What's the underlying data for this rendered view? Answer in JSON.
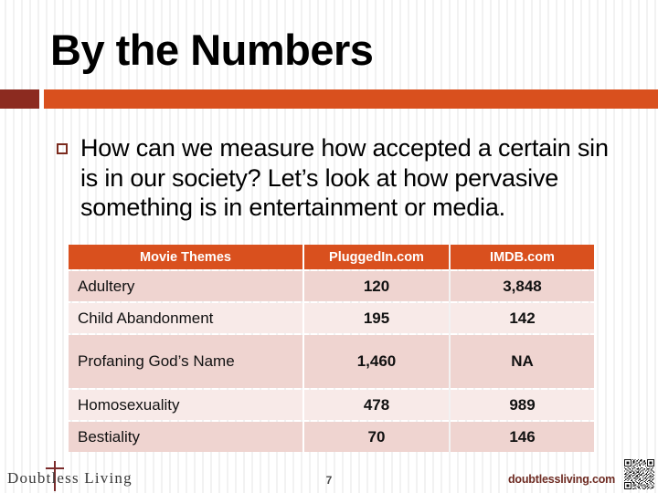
{
  "slide": {
    "title": "By the Numbers",
    "accent_color": "#D9501E",
    "accent_dark_color": "#8C2B20",
    "bullet_color": "#7B2B1E",
    "row_dark_color": "#EFD4D0",
    "row_light_color": "#F8EAE8"
  },
  "body": {
    "bullet_marker": "hollow-square-bullet",
    "paragraph": "How can we measure how accepted a certain sin is in our society? Let’s look at how pervasive something is in entertainment or media."
  },
  "table": {
    "headers": [
      "Movie Themes",
      "PluggedIn.com",
      "IMDB.com"
    ],
    "rows": [
      {
        "theme": "Adultery",
        "pluggedin": "120",
        "imdb": "3,848"
      },
      {
        "theme": "Child Abandonment",
        "pluggedin": "195",
        "imdb": "142"
      },
      {
        "theme": "Profaning God’s Name",
        "pluggedin": "1,460",
        "imdb": "NA"
      },
      {
        "theme": "Homosexuality",
        "pluggedin": "478",
        "imdb": "989"
      },
      {
        "theme": "Bestiality",
        "pluggedin": "70",
        "imdb": "146"
      }
    ]
  },
  "footer": {
    "logo_text": "Doubtless Living",
    "logo_icon": "cross-icon",
    "page_number": "7",
    "website": "doubtlessliving.com",
    "qr_icon": "qr-code-icon"
  }
}
